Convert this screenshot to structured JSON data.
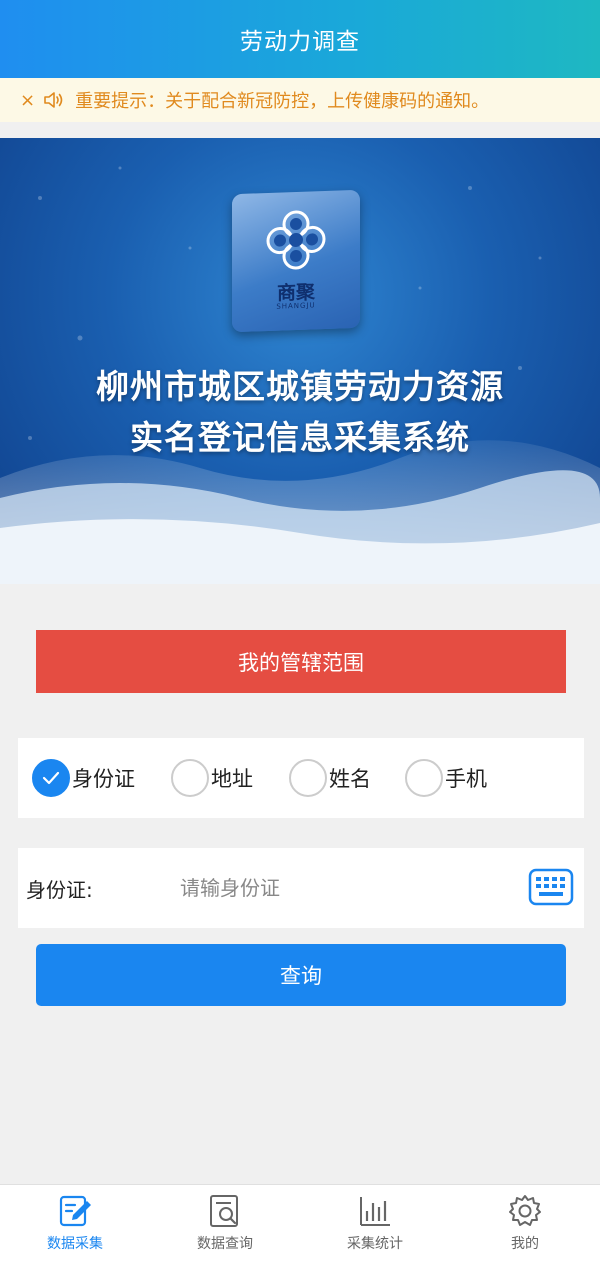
{
  "header": {
    "title": "劳动力调查"
  },
  "notice": {
    "close_icon": "×",
    "text": "重要提示：关于配合新冠防控，上传健康码的通知。"
  },
  "banner": {
    "logo_text": "商聚",
    "logo_sub": "SHANGJU",
    "title_line1": "柳州市城区城镇劳动力资源",
    "title_line2": "实名登记信息采集系统"
  },
  "scope_button": {
    "label": "我的管辖范围"
  },
  "search_type": {
    "options": [
      {
        "label": "身份证",
        "checked": true
      },
      {
        "label": "地址",
        "checked": false
      },
      {
        "label": "姓名",
        "checked": false
      },
      {
        "label": "手机",
        "checked": false
      }
    ]
  },
  "id_field": {
    "label": "身份证:",
    "placeholder": "请输身份证",
    "value": ""
  },
  "query_button": {
    "label": "查询"
  },
  "tabbar": {
    "items": [
      {
        "label": "数据采集",
        "icon": "edit-icon",
        "active": true
      },
      {
        "label": "数据查询",
        "icon": "search-doc-icon",
        "active": false
      },
      {
        "label": "采集统计",
        "icon": "bar-chart-icon",
        "active": false
      },
      {
        "label": "我的",
        "icon": "gear-icon",
        "active": false
      }
    ]
  },
  "colors": {
    "primary": "#1a86f0",
    "danger": "#e54d42",
    "notice_text": "#e08a1e",
    "notice_bg": "#fdf9e6"
  }
}
